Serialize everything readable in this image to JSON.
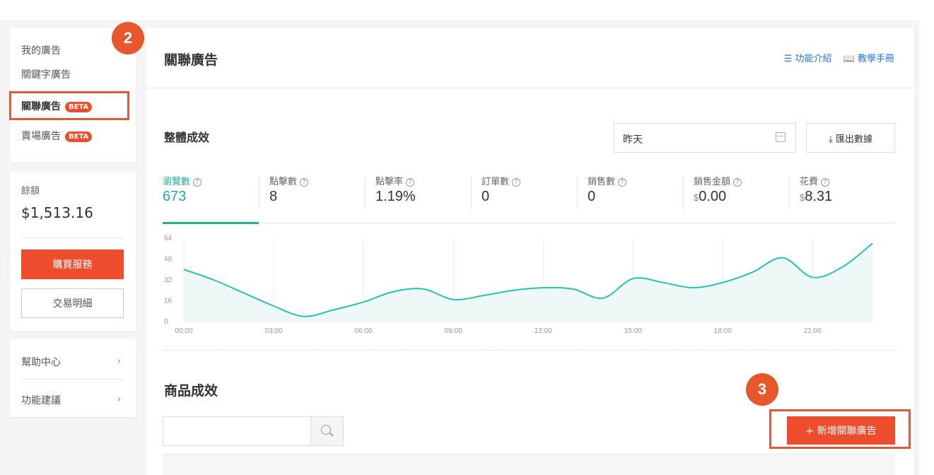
{
  "sidebar": {
    "nav": [
      {
        "label": "我的廣告"
      },
      {
        "label": "關鍵字廣告"
      },
      {
        "label": "關聯廣告",
        "badge": "BETA"
      },
      {
        "label": "賣場廣告",
        "badge": "BETA"
      }
    ],
    "balance": {
      "label": "餘額",
      "value": "$1,513.16",
      "buy_label": "購買服務",
      "transactions_label": "交易明細"
    },
    "help": [
      {
        "label": "幫助中心"
      },
      {
        "label": "功能建議"
      }
    ]
  },
  "markers": {
    "step2": "2",
    "step3": "3"
  },
  "header": {
    "title": "關聯廣告",
    "link_intro": "功能介紹",
    "link_manual": "教學手冊"
  },
  "overall": {
    "title": "整體成效",
    "date_value": "昨天",
    "export_label": "匯出數據",
    "metrics": [
      {
        "label": "瀏覽數",
        "value": "673",
        "active": true
      },
      {
        "label": "點擊數",
        "value": "8"
      },
      {
        "label": "點擊率",
        "value": "1.19%"
      },
      {
        "label": "訂單數",
        "value": "0"
      },
      {
        "label": "銷售數",
        "value": "0"
      },
      {
        "label": "銷售金額",
        "currency": "$",
        "value": "0.00"
      },
      {
        "label": "花費",
        "currency": "$",
        "value": "8.31"
      }
    ]
  },
  "chart_data": {
    "type": "area",
    "x": [
      "00:00",
      "01:00",
      "02:00",
      "03:00",
      "04:00",
      "05:00",
      "06:00",
      "07:00",
      "08:00",
      "09:00",
      "10:00",
      "11:00",
      "12:00",
      "13:00",
      "14:00",
      "15:00",
      "16:00",
      "17:00",
      "18:00",
      "19:00",
      "20:00",
      "21:00",
      "22:00",
      "23:00"
    ],
    "values": [
      40,
      32,
      22,
      12,
      4,
      9,
      15,
      23,
      25,
      17,
      20,
      24,
      26,
      25,
      18,
      33,
      30,
      26,
      30,
      38,
      49,
      34,
      42,
      60
    ],
    "x_ticks": [
      "00:00",
      "03:00",
      "06:00",
      "09:00",
      "12:00",
      "15:00",
      "18:00",
      "21:00"
    ],
    "y_ticks": [
      "0",
      "16",
      "32",
      "48",
      "64"
    ],
    "ylim": [
      0,
      64
    ],
    "grid": "vertical",
    "color": "#26c4aa",
    "fill": "#eef9f7"
  },
  "products": {
    "title": "商品成效",
    "search_placeholder": "",
    "add_label": "+ 新增關聯廣告"
  }
}
